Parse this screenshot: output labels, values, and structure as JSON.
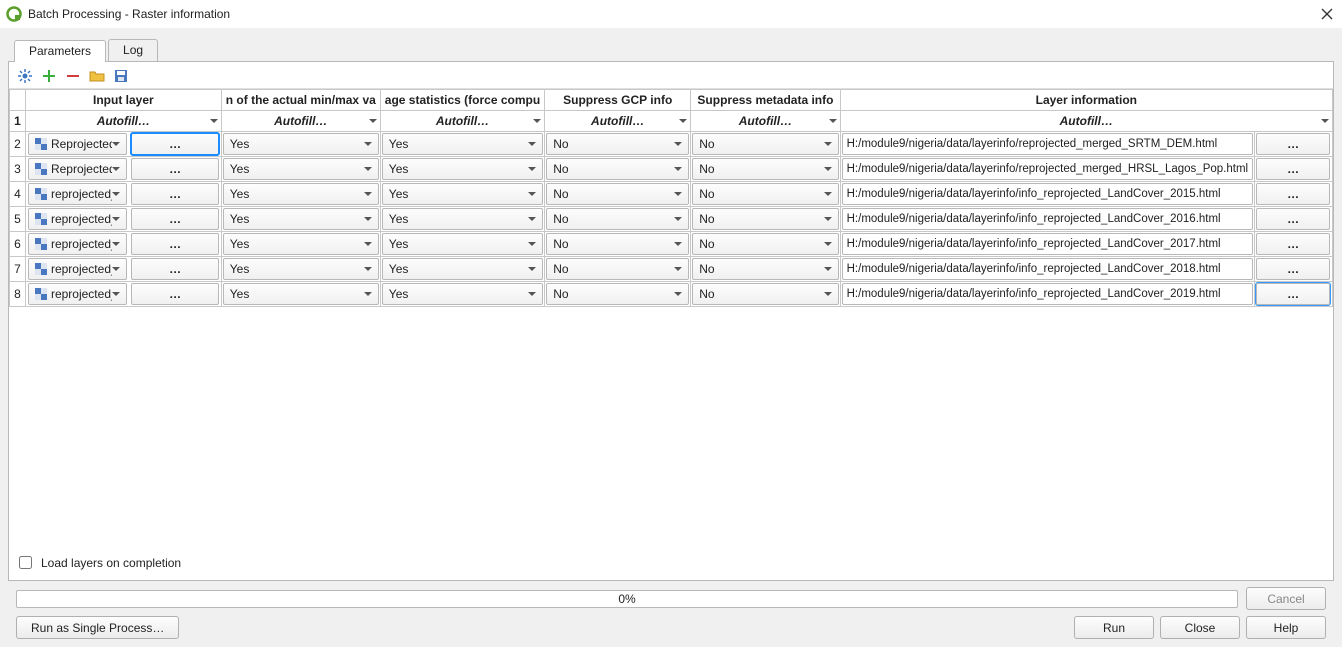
{
  "window": {
    "title": "Batch Processing - Raster information"
  },
  "tabs": {
    "parameters": "Parameters",
    "log": "Log"
  },
  "toolbar_icons": {
    "settings": "settings-icon",
    "add": "add-row-icon",
    "remove": "remove-row-icon",
    "open": "open-icon",
    "save": "save-icon"
  },
  "headers": {
    "input": "Input layer",
    "minmax": "n of the actual min/max va",
    "stats": "age statistics (force compu",
    "gcp": "Suppress GCP info",
    "meta": "Suppress metadata info",
    "output": "Layer information"
  },
  "autofill": "Autofill…",
  "select": {
    "yes": "Yes",
    "no": "No"
  },
  "rows": [
    {
      "n": "2",
      "layer": "Reprojected_merged_",
      "minmax": "Yes",
      "stats": "Yes",
      "gcp": "No",
      "meta": "No",
      "out": "H:/module9/nigeria/data/layerinfo/reprojected_merged_SRTM_DEM.html"
    },
    {
      "n": "3",
      "layer": "Reprojected_HRSL_La",
      "minmax": "Yes",
      "stats": "Yes",
      "gcp": "No",
      "meta": "No",
      "out": "H:/module9/nigeria/data/layerinfo/reprojected_merged_HRSL_Lagos_Pop.html"
    },
    {
      "n": "4",
      "layer": "reprojected_LandCov",
      "minmax": "Yes",
      "stats": "Yes",
      "gcp": "No",
      "meta": "No",
      "out": "H:/module9/nigeria/data/layerinfo/info_reprojected_LandCover_2015.html"
    },
    {
      "n": "5",
      "layer": "reprojected_LandCov",
      "minmax": "Yes",
      "stats": "Yes",
      "gcp": "No",
      "meta": "No",
      "out": "H:/module9/nigeria/data/layerinfo/info_reprojected_LandCover_2016.html"
    },
    {
      "n": "6",
      "layer": "reprojected_LandCov",
      "minmax": "Yes",
      "stats": "Yes",
      "gcp": "No",
      "meta": "No",
      "out": "H:/module9/nigeria/data/layerinfo/info_reprojected_LandCover_2017.html"
    },
    {
      "n": "7",
      "layer": "reprojected_LandCov",
      "minmax": "Yes",
      "stats": "Yes",
      "gcp": "No",
      "meta": "No",
      "out": "H:/module9/nigeria/data/layerinfo/info_reprojected_LandCover_2018.html"
    },
    {
      "n": "8",
      "layer": "reprojected_LandCov",
      "minmax": "Yes",
      "stats": "Yes",
      "gcp": "No",
      "meta": "No",
      "out": "H:/module9/nigeria/data/layerinfo/info_reprojected_LandCover_2019.html"
    }
  ],
  "ellipsis": "…",
  "check": {
    "load_layers": "Load layers on completion"
  },
  "progress": {
    "text": "0%"
  },
  "buttons": {
    "cancel": "Cancel",
    "single": "Run as Single Process…",
    "run": "Run",
    "close": "Close",
    "help": "Help"
  }
}
